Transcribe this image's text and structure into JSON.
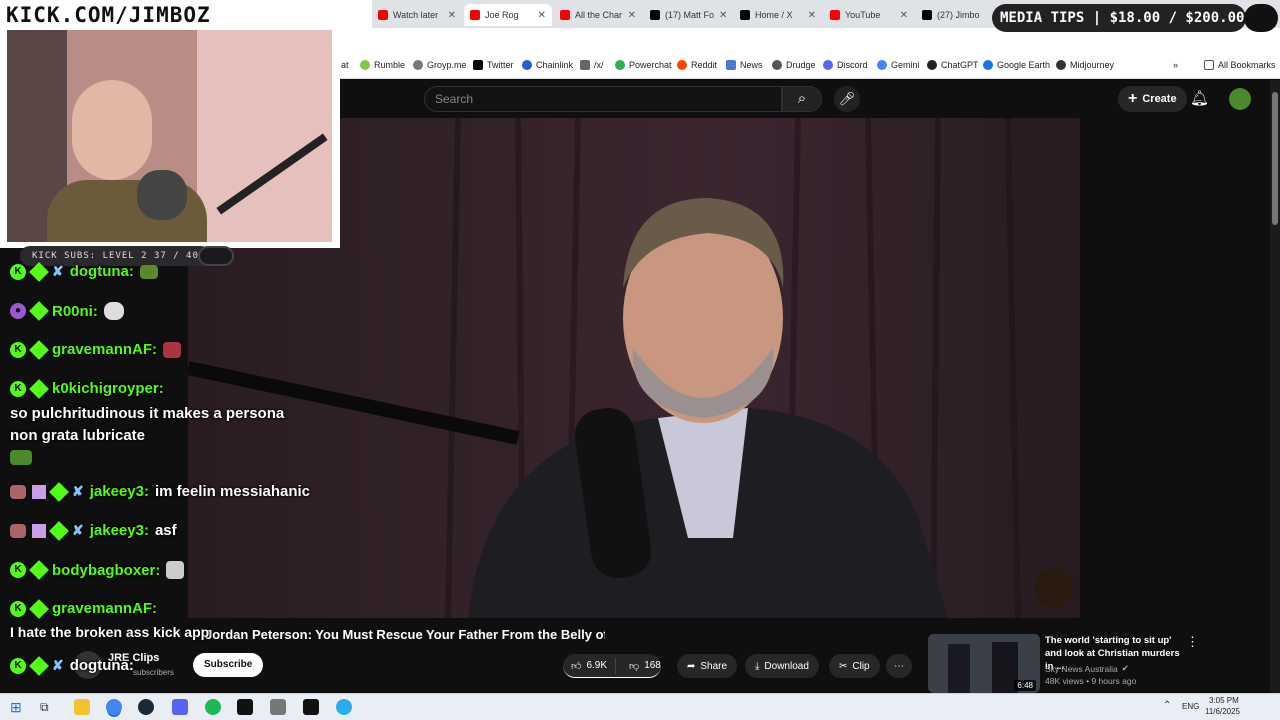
{
  "overlay": {
    "stream_url": "KICK.COM/JIMBOZ",
    "media_tips": "MEDIA TIPS | $18.00 / $200.00",
    "kick_subs": "KICK SUBS: LEVEL 2 37 / 40"
  },
  "tabs": [
    {
      "label": "Watch later",
      "color": "#ff0000"
    },
    {
      "label": "Joe Rog",
      "color": "#ff0000"
    },
    {
      "label": "All the Char",
      "color": "#ff0000"
    },
    {
      "label": "(17) Matt Fo",
      "color": "#000000"
    },
    {
      "label": "Home / X",
      "color": "#000000"
    },
    {
      "label": "YouTube",
      "color": "#ff0000"
    },
    {
      "label": "(27) Jimbo",
      "color": "#000000"
    }
  ],
  "bookmarks": [
    {
      "label": "at",
      "color": "#888888"
    },
    {
      "label": "Rumble",
      "color": "#85c742"
    },
    {
      "label": "Groyp.me",
      "color": "#777777"
    },
    {
      "label": "Twitter",
      "color": "#000000"
    },
    {
      "label": "Chainlink",
      "color": "#2a5ada"
    },
    {
      "label": "/x/",
      "color": "#666666"
    },
    {
      "label": "Powerchat",
      "color": "#2bb24c"
    },
    {
      "label": "Reddit",
      "color": "#ff4500"
    },
    {
      "label": "News",
      "color": "#4a7bd0"
    },
    {
      "label": "Drudge",
      "color": "#555555"
    },
    {
      "label": "Discord",
      "color": "#5865f2"
    },
    {
      "label": "Gemini",
      "color": "#4285f4"
    },
    {
      "label": "ChatGPT",
      "color": "#222222"
    },
    {
      "label": "Google Earth",
      "color": "#1a73e8"
    },
    {
      "label": "Midjourney",
      "color": "#333333"
    }
  ],
  "all_bookmarks": "All Bookmarks",
  "youtube": {
    "search_placeholder": "Search",
    "create_label": "Create",
    "video_title": "Jordan Peterson: You Must Rescue Your Father From the Belly of the Whale",
    "channel": "JRE Clips",
    "subscribers": "subscribers",
    "subscribe_label": "Subscribe",
    "likes": "6.9K",
    "dislikes": "168",
    "share_label": "Share",
    "download_label": "Download",
    "clip_label": "Clip",
    "recommended": {
      "title": "The world 'starting to sit up' and look at Christian murders in ...",
      "channel": "Sky News Australia",
      "meta": "48K views • 9 hours ago",
      "duration": "6:48"
    }
  },
  "chat": [
    {
      "user": "dogtuna:",
      "msg": ""
    },
    {
      "user": "R00ni:",
      "msg": ""
    },
    {
      "user": "gravemannAF:",
      "msg": ""
    },
    {
      "user": "k0kichigroyper:",
      "msg": "so pulchritudinous it makes a persona non grata lubricate"
    },
    {
      "user": "jakeey3:",
      "msg": "im feelin messiahanic"
    },
    {
      "user": "jakeey3:",
      "msg": "asf"
    },
    {
      "user": "bodybagboxer:",
      "msg": ""
    },
    {
      "user": "gravemannAF:",
      "msg": ""
    },
    {
      "user": "",
      "msg": "I hate the broken ass kick app"
    },
    {
      "user": "dogtuna:",
      "msg": ""
    }
  ],
  "taskbar": {
    "lang": "ENG",
    "time": "3:05 PM",
    "date": "11/6/2025"
  }
}
